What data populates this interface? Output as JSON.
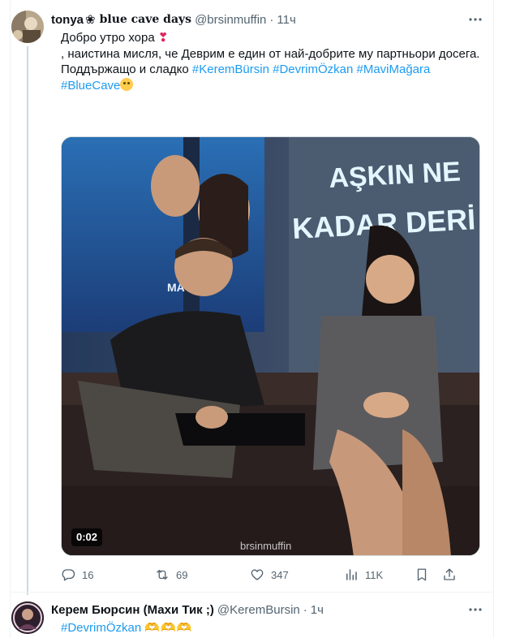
{
  "tweet1": {
    "display_name": "tonya",
    "display_name_flower": "❀",
    "display_name_suffix": "𝐛𝐥𝐮𝐞 𝐜𝐚𝐯𝐞 𝐝𝐚𝐲𝐬",
    "handle": "@brsinmuffin",
    "separator": "·",
    "time": "11ч",
    "text_line1": "Добро утро хора",
    "text_line1_emoji": "❣",
    "text_line2": ", наистина мисля, че Деврим е един от най-добрите му партньори досега.",
    "text_line3_prefix": "Поддържащо и сладко",
    "hashtags_line3": [
      "#KeremBürsin",
      "#DevrimÖzkan",
      "#MaviMağara"
    ],
    "hashtag_line4": "#BlueCave",
    "media": {
      "duration": "0:02",
      "poster_text_1": "AŞKIN NE",
      "poster_text_2": "KADAR DERİ",
      "poster_small": "MA ARA",
      "watermark": "brsinmuffin"
    },
    "stats": {
      "replies": "16",
      "retweets": "69",
      "likes": "347",
      "views": "11K"
    }
  },
  "tweet2": {
    "display_name": "Керем Бюрсин (Махи Тик ;)",
    "handle": "@KeremBursin",
    "separator": "·",
    "time": "1ч",
    "hashtag": "#DevrimÖzkan",
    "emoji_hands": "🫶🫶🫶"
  },
  "icons": {
    "more": "more-icon",
    "reply": "reply-icon",
    "retweet": "retweet-icon",
    "like": "heart-icon",
    "views": "views-icon",
    "bookmark": "bookmark-icon",
    "share": "share-icon"
  },
  "colors": {
    "text": "#0f1419",
    "secondary": "#536471",
    "link": "#1d9bf0",
    "border": "#eff3f4"
  }
}
